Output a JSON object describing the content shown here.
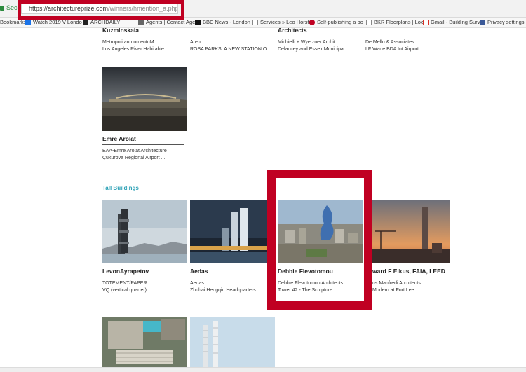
{
  "browser": {
    "secure_label": "Secu",
    "url_host": "https://architectureprize.com",
    "url_path": "/winners/hmention_a.php"
  },
  "bookmarks": [
    {
      "label": "Bookmarks",
      "color": "#555555"
    },
    {
      "label": "Watch 2019 V Londo",
      "color": "#1a73e8"
    },
    {
      "label": "ARCHDAILY",
      "color": "#222222"
    },
    {
      "label": "Agents | Contact Age",
      "color": "#666666"
    },
    {
      "label": "BBC News - London",
      "color": "#111111"
    },
    {
      "label": "Services » Leo Horsfi",
      "color": "#888888"
    },
    {
      "label": "Self-publishing a bo",
      "color": "#c00022"
    },
    {
      "label": "BKR Floorplans | Loca",
      "color": "#888888"
    },
    {
      "label": "Gmail - Building Surv",
      "color": "#d93025"
    },
    {
      "label": "Privacy settings",
      "color": "#3b5998"
    }
  ],
  "top_row": [
    {
      "name": "Kuzminskaia",
      "firm": "MetropolitanmomentuM",
      "project": "Los Angeles River Habitable..."
    },
    {
      "name": "",
      "firm": "Arep",
      "project": "ROSA PARKS: A NEW STATION O..."
    },
    {
      "name": "Architects",
      "firm": "Michielli + Wyetzner Archit...",
      "project": "Delancey and Essex Municipa..."
    },
    {
      "name": "",
      "firm": "De Mello & Associates",
      "project": "LF Wade BDA Int Airport"
    }
  ],
  "airport_entry": {
    "name": "Emre Arolat",
    "firm": "EAA-Emre Arolat Architecture",
    "project": "Çukurova Regional Airport ..."
  },
  "section_title": "Tall Buildings",
  "tall_buildings": [
    {
      "name": "LevonAyrapetov",
      "firm": "TOTEMENT/PAPER",
      "project": "VQ (vertical quarter)"
    },
    {
      "name": "Aedas",
      "firm": "Aedas",
      "project": "Zhuhai Hengqin Headquarters..."
    },
    {
      "name": "Debbie Flevotomou",
      "firm": "Debbie Flevotomou Architects",
      "project": "Tower 42 - The Sculpture"
    },
    {
      "name": "ward F Elkus, FAIA, LEED",
      "firm": "us Manfredi Architects",
      "project": "Modern at Fort Lee"
    }
  ]
}
